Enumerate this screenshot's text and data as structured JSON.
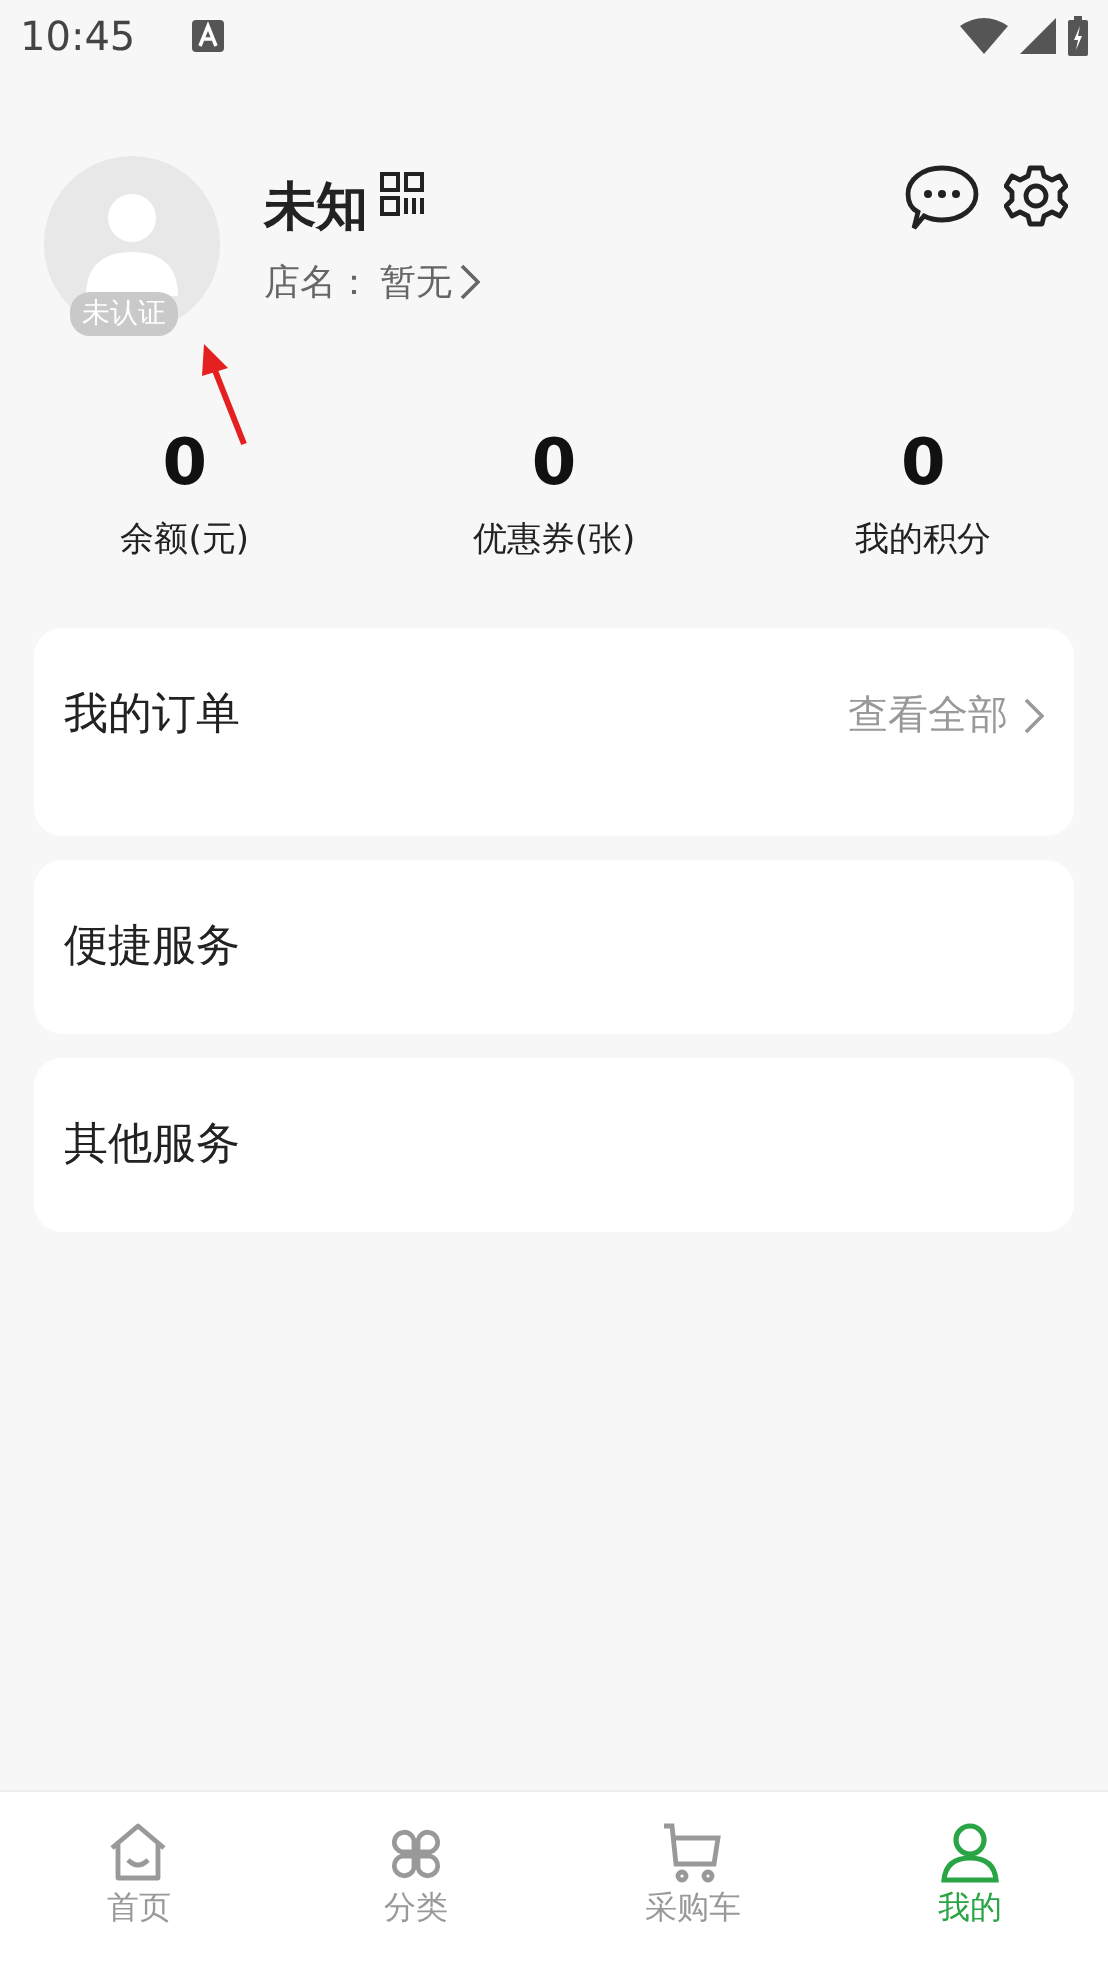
{
  "status_bar": {
    "time": "10:45"
  },
  "profile": {
    "name": "未知",
    "badge": "未认证",
    "store_label": "店名：",
    "store_value": "暂无"
  },
  "stats": [
    {
      "value": "0",
      "label": "余额(元)"
    },
    {
      "value": "0",
      "label": "优惠券(张)"
    },
    {
      "value": "0",
      "label": "我的积分"
    }
  ],
  "cards": [
    {
      "title": "我的订单",
      "link": "查看全部"
    },
    {
      "title": "便捷服务"
    },
    {
      "title": "其他服务"
    }
  ],
  "tab_bar": [
    {
      "label": "首页",
      "selected": false
    },
    {
      "label": "分类",
      "selected": false
    },
    {
      "label": "采购车",
      "selected": false
    },
    {
      "label": "我的",
      "selected": true
    }
  ]
}
